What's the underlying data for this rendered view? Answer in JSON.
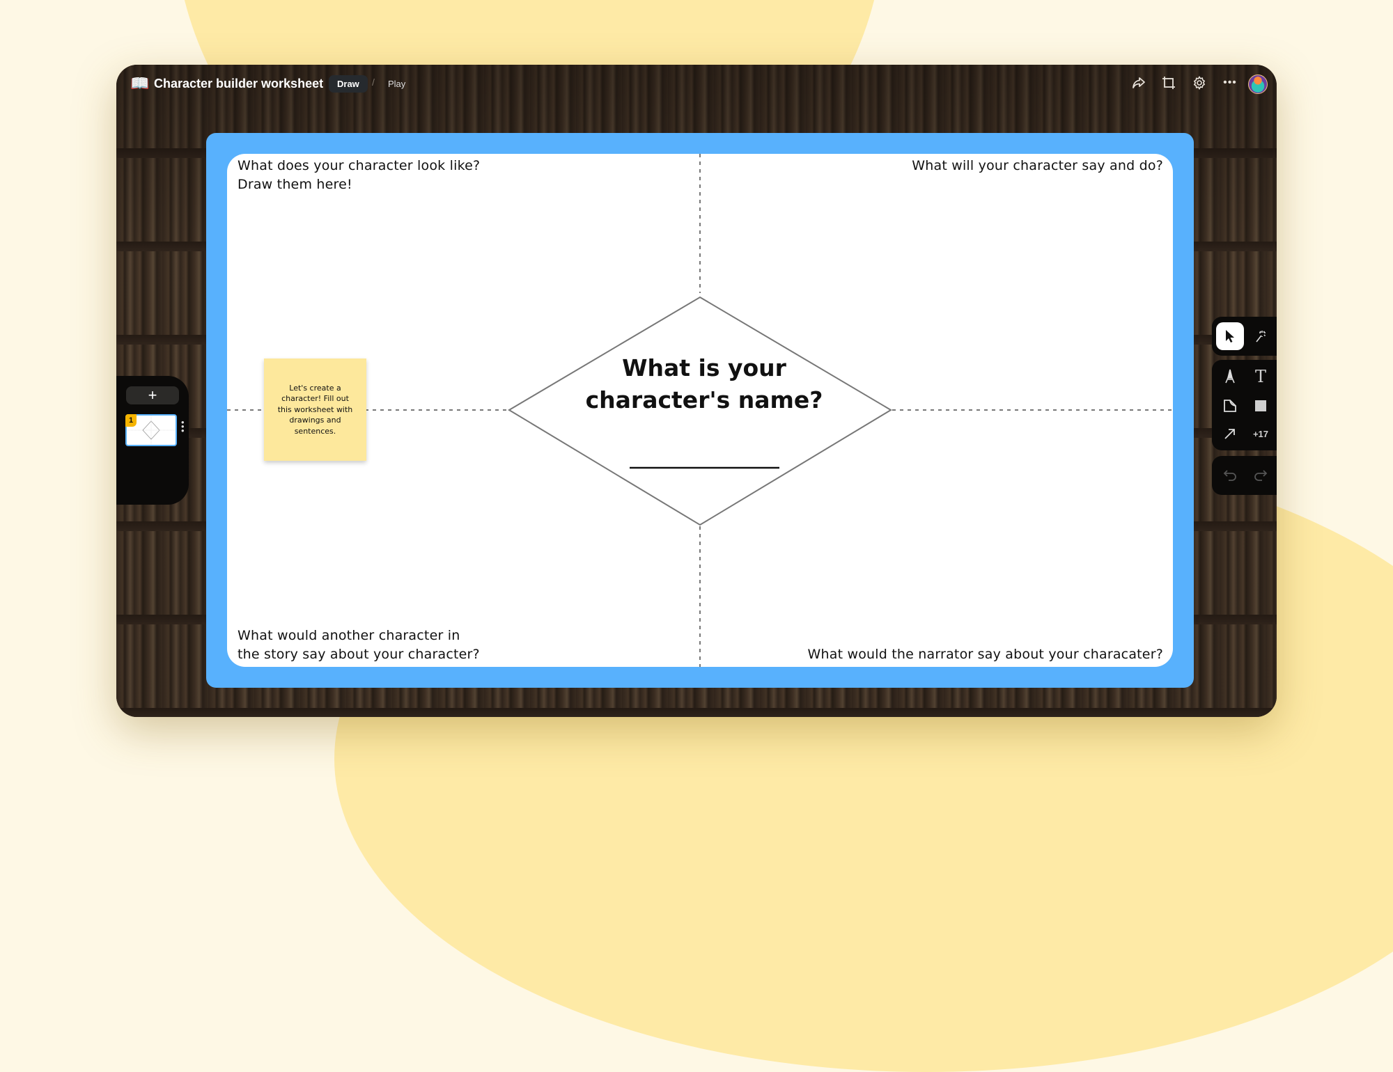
{
  "window": {
    "title_icon": "open-book-icon",
    "title": "Character builder worksheet",
    "modes": {
      "draw": "Draw",
      "separator": "/",
      "play": "Play"
    },
    "active_mode": "Draw",
    "toolbar_icons": [
      "share-icon",
      "crop-frame-icon",
      "settings-gear-icon",
      "more-horizontal-icon",
      "user-avatar"
    ]
  },
  "board": {
    "accent_color": "#58b1fd",
    "questions": {
      "top_left": [
        "What does your character look like?",
        "Draw them here!"
      ],
      "top_right": [
        "What will your character say and do?"
      ],
      "bottom_left": [
        "What would another character in",
        "the story say about your character?"
      ],
      "bottom_right": [
        "What would the narrator say about your characater?"
      ]
    },
    "center": {
      "title_lines": [
        "What is your",
        "character's name?"
      ],
      "answer_value": ""
    },
    "sticky_note": {
      "text": "Let's create a character! Fill out this worksheet with drawings and sentences.",
      "color": "#fde89c"
    }
  },
  "pages_panel": {
    "add_label": "+",
    "pages": [
      {
        "number": "1",
        "selected": true
      }
    ],
    "badge_color": "#f5b400"
  },
  "tools": {
    "group1": [
      {
        "name": "select",
        "icon": "pointer-arrow-icon",
        "active": true
      },
      {
        "name": "magic",
        "icon": "magic-wand-icon"
      }
    ],
    "group2": [
      {
        "name": "pen",
        "icon": "pen-nib-icon"
      },
      {
        "name": "text",
        "icon": "text-icon",
        "label": "T"
      },
      {
        "name": "sticky",
        "icon": "sticky-note-icon"
      },
      {
        "name": "shape",
        "icon": "square-shape-icon"
      },
      {
        "name": "arrow",
        "icon": "arrow-diagonal-icon"
      },
      {
        "name": "more",
        "label": "+17"
      }
    ],
    "group3": [
      {
        "name": "undo",
        "icon": "undo-icon"
      },
      {
        "name": "redo",
        "icon": "redo-icon"
      }
    ]
  }
}
